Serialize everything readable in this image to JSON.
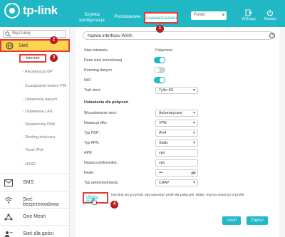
{
  "header": {
    "logo_text": "tp-link",
    "tabs": [
      {
        "label": "Szybka konfiguracja"
      },
      {
        "label": "Podstawowe"
      },
      {
        "label": "Zaawansowane"
      }
    ],
    "language": "Polski",
    "logout_label": "Wyloguj",
    "restart_label": "Restart"
  },
  "sidebar": {
    "search_placeholder": "Wyszukaj",
    "network_label": "Sieć",
    "subitems": [
      "- Internet",
      "- Aktualizacja ISP",
      "- Zarządzanie kodem PIN",
      "- Ustawienia danych",
      "- Ustawienia LAN",
      "- Dynamiczny DNS",
      "- Routing statyczny",
      "- Tunel IPv6",
      "- USSD"
    ],
    "items": [
      {
        "label": "SMS",
        "icon": "sms-icon"
      },
      {
        "label": "Sieć bezprzewodowa",
        "icon": "wifi-icon"
      },
      {
        "label": "One Mesh",
        "icon": "mesh-icon"
      },
      {
        "label": "Sieć dla gości",
        "icon": "guest-network-icon"
      }
    ]
  },
  "main": {
    "wan_name_placeholder": "Nazwa interfejsu WAN:",
    "internet_status_label": "Stan Internetu:",
    "internet_status_value": "Połączono",
    "cellular_label": "Dane sieci komórkowej",
    "roaming_label": "Roaming danych",
    "nat_label": "NAT",
    "network_mode_label": "Tryb sieci:",
    "network_mode_value": "Tylko 4G",
    "connection_settings_title": "Ustawienia dla połączeń",
    "network_search_label": "Wyszukiwanie sieci:",
    "network_search_value": "Automatyczne",
    "profile_name_label": "Nazwa profilu:",
    "profile_name_value": "VPN",
    "pdp_type_label": "Typ PDP:",
    "pdp_type_value": "IPv4",
    "apn_type_label": "Typ APN:",
    "apn_type_value": "Static",
    "apn_label": "APN:",
    "apn_value": "vpn",
    "username_label": "Nazwa użytkownika:",
    "username_value": "vpn",
    "password_label": "Hasło:",
    "password_value": "•••",
    "auth_type_label": "Typ uwierzytelniania:",
    "auth_type_value": "CHAP",
    "create_profile_label": "Utwórz profil",
    "create_profile_hint": "Naciśnij ten przycisk, aby utworzyć profil dla połączeń. Maks. można utworzyć 8 profili.",
    "cancel_label": "Usuń",
    "save_label": "Zapisz"
  },
  "annotations": [
    "1",
    "2",
    "3",
    "4"
  ],
  "colors": {
    "accent": "#1fb8c4",
    "highlight": "#ffd54f",
    "marker": "#e53935",
    "badge": "#b71c1c"
  }
}
